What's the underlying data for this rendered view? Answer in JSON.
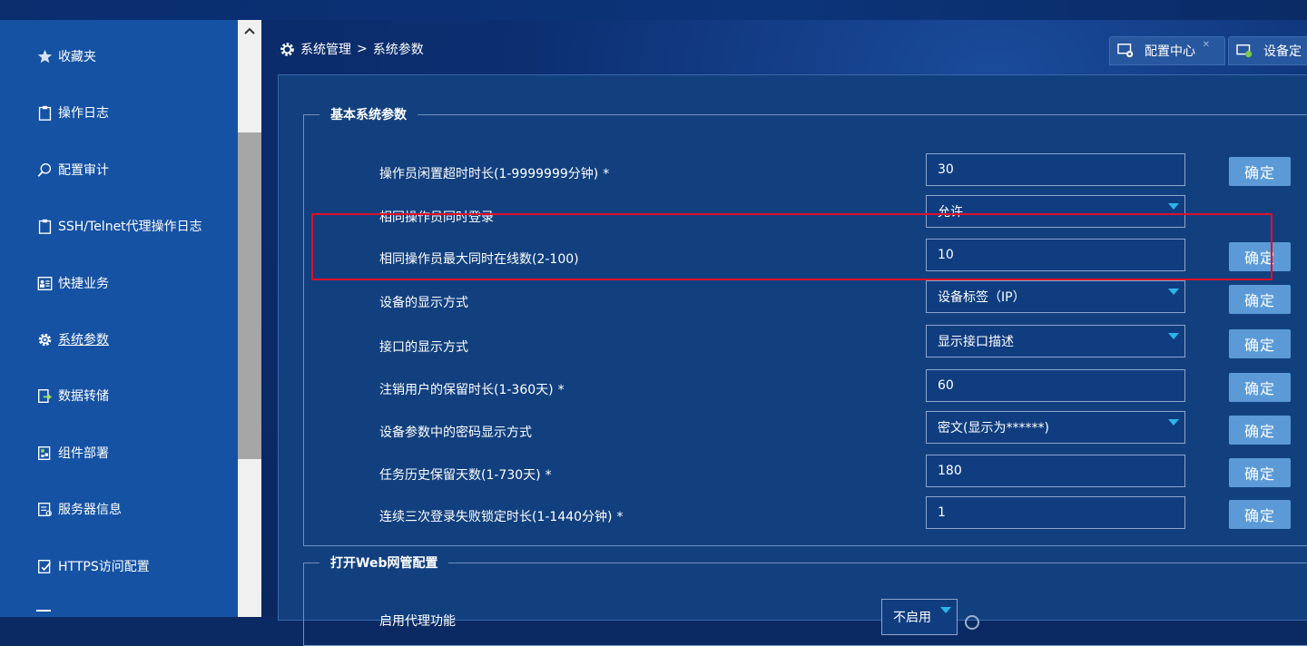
{
  "sidebar": {
    "items": [
      {
        "label": "收藏夹",
        "icon": "star-icon"
      },
      {
        "label": "操作日志",
        "icon": "clipboard-icon"
      },
      {
        "label": "配置审计",
        "icon": "search-icon"
      },
      {
        "label": "SSH/Telnet代理操作日志",
        "icon": "clipboard-icon"
      },
      {
        "label": "快捷业务",
        "icon": "id-card-icon"
      },
      {
        "label": "系统参数",
        "icon": "gear-icon"
      },
      {
        "label": "数据转储",
        "icon": "data-transfer-icon"
      },
      {
        "label": "组件部署",
        "icon": "component-icon"
      },
      {
        "label": "服务器信息",
        "icon": "server-info-icon"
      },
      {
        "label": "HTTPS访问配置",
        "icon": "https-config-icon"
      }
    ],
    "active_index": 5
  },
  "breadcrumb": {
    "root": "系统管理",
    "sep": ">",
    "current": "系统参数"
  },
  "tabs": [
    {
      "label": "配置中心"
    },
    {
      "label": "设备定"
    }
  ],
  "section_basic": {
    "title": "基本系统参数",
    "rows": [
      {
        "label": "操作员闲置超时时长(1-9999999分钟)",
        "required": "*",
        "value": "30",
        "kind": "input",
        "button": "确定"
      },
      {
        "label": "相同操作员同时登录",
        "required": "",
        "value": "允许",
        "kind": "select",
        "button": ""
      },
      {
        "label": "相同操作员最大同时在线数(2-100)",
        "required": "",
        "value": "10",
        "kind": "input",
        "button": "确定"
      },
      {
        "label": "设备的显示方式",
        "required": "",
        "value": "设备标签（IP）",
        "kind": "select",
        "button": "确定"
      },
      {
        "label": "接口的显示方式",
        "required": "",
        "value": "显示接口描述",
        "kind": "select",
        "button": "确定"
      },
      {
        "label": "注销用户的保留时长(1-360天)",
        "required": "*",
        "value": "60",
        "kind": "input",
        "button": "确定"
      },
      {
        "label": "设备参数中的密码显示方式",
        "required": "",
        "value": "密文(显示为******)",
        "kind": "select",
        "button": "确定"
      },
      {
        "label": "任务历史保留天数(1-730天)",
        "required": "*",
        "value": "180",
        "kind": "input",
        "button": "确定"
      },
      {
        "label": "连续三次登录失败锁定时长(1-1440分钟)",
        "required": "*",
        "value": "1",
        "kind": "input",
        "button": "确定"
      }
    ]
  },
  "section_web": {
    "title": "打开Web网管配置",
    "rows": [
      {
        "label": "启用代理功能",
        "value": "不启用",
        "kind": "select"
      }
    ]
  },
  "colors": {
    "sidebar": "#1552a4",
    "button": "#5b9ad6",
    "highlight": "#e0102a",
    "caret": "#2cb5e8"
  }
}
